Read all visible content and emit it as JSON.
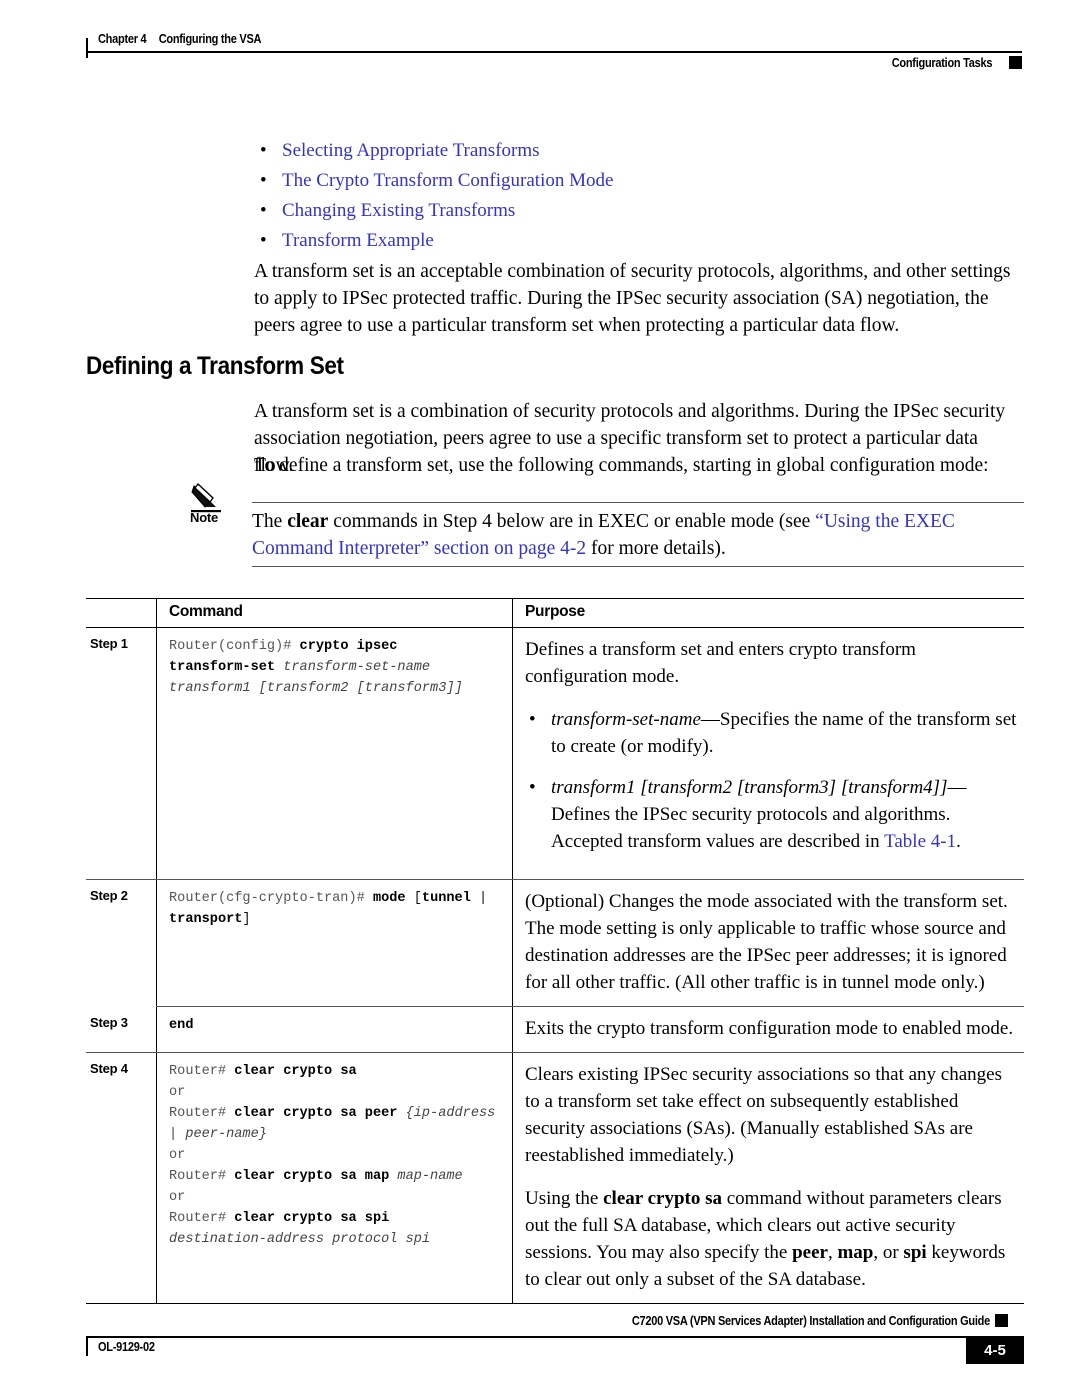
{
  "header": {
    "chapter_number": "Chapter 4",
    "chapter_title": "Configuring the VSA",
    "section": "Configuration Tasks"
  },
  "bullets": [
    {
      "label": "Selecting Appropriate Transforms"
    },
    {
      "label": "The Crypto Transform Configuration Mode"
    },
    {
      "label": "Changing Existing Transforms"
    },
    {
      "label": "Transform Example"
    }
  ],
  "intro_paragraph": "A transform set is an acceptable combination of security protocols, algorithms, and other settings to apply to IPSec protected traffic. During the IPSec security association (SA) negotiation, the peers agree to use a particular transform set when protecting a particular data flow.",
  "heading": "Defining a Transform Set",
  "paragraph_1": "A transform set is a combination of security protocols and algorithms. During the IPSec security association negotiation, peers agree to use a specific transform set to protect a particular data flow.",
  "paragraph_2": "To define a transform set, use the following commands, starting in global configuration mode:",
  "note": {
    "label": "Note",
    "text_part_1": "The ",
    "text_bold": "clear",
    "text_part_2": " commands in Step 4 below are in EXEC or enable mode (see ",
    "link_1": "“Using the EXEC Command Interpreter” section on page 4-2",
    "text_part_3": " for more details)."
  },
  "table": {
    "columns": {
      "step": "",
      "command": "Command",
      "purpose": "Purpose"
    },
    "rows": [
      {
        "step": "Step 1",
        "command_lines": [
          {
            "prompt": "Router(config)# ",
            "bold": "crypto ipsec",
            "italic": ""
          },
          {
            "prompt": "",
            "bold": "transform-set ",
            "italic": "transform-set-name"
          },
          {
            "prompt": "",
            "bold": "",
            "italic": "transform1 [transform2 [transform3]]"
          }
        ],
        "purpose_intro": "Defines a transform set and enters crypto transform configuration mode.",
        "purpose_bullets": [
          {
            "italic_lead": "transform-set-name",
            "rest": "—Specifies the name of the transform set to create (or modify)."
          },
          {
            "italic_lead": "transform1 [transform2 [transform3] [transform4]]",
            "rest": "—Defines the IPSec security protocols and algorithms. Accepted transform values are described in ",
            "link": "Table 4-1",
            "tail": "."
          }
        ]
      },
      {
        "step": "Step 2",
        "command_lines": [
          {
            "prompt": "Router(cfg-crypto-tran)# ",
            "bold": "mode ",
            "plain": "[",
            "bold2": "tunnel",
            "plain2": " |"
          },
          {
            "prompt": "",
            "bold": "transport",
            "plain": "]"
          }
        ],
        "purpose_intro": "(Optional) Changes the mode associated with the transform set. The mode setting is only applicable to traffic whose source and destination addresses are the IPSec peer addresses; it is ignored for all other traffic. (All other traffic is in tunnel mode only.)",
        "purpose_bullets": []
      },
      {
        "step": "Step 3",
        "command_lines": [
          {
            "prompt": "",
            "bold": "end",
            "italic": ""
          }
        ],
        "purpose_intro": "Exits the crypto transform configuration mode to enabled mode.",
        "purpose_bullets": []
      },
      {
        "step": "Step 4",
        "command_lines": [
          {
            "prompt": "Router# ",
            "bold": "clear crypto sa",
            "italic": ""
          },
          {
            "prompt": "or",
            "bold": "",
            "italic": ""
          },
          {
            "prompt": "Router# ",
            "bold": "clear crypto sa peer ",
            "italic": "{ip-address"
          },
          {
            "prompt": "",
            "bold": "",
            "italic": "| peer-name}"
          },
          {
            "prompt": "or",
            "bold": "",
            "italic": ""
          },
          {
            "prompt": "Router# ",
            "bold": "clear crypto sa map ",
            "italic": "map-name"
          },
          {
            "prompt": "or",
            "bold": "",
            "italic": ""
          },
          {
            "prompt": "Router# ",
            "bold": "clear crypto sa spi",
            "italic": ""
          },
          {
            "prompt": "",
            "bold": "",
            "italic": "destination-address protocol spi"
          }
        ],
        "purpose_intro": "Clears existing IPSec security associations so that any changes to a transform set take effect on subsequently established security associations (SAs). (Manually established SAs are reestablished immediately.)",
        "purpose_extra_pre": "Using the ",
        "purpose_extra_bold": "clear crypto sa",
        "purpose_extra_mid": " command without parameters clears out the full SA database, which clears out active security sessions. You may also specify the ",
        "purpose_extra_b1": "peer",
        "purpose_extra_sep1": ", ",
        "purpose_extra_b2": "map",
        "purpose_extra_sep2": ", or ",
        "purpose_extra_b3": "spi",
        "purpose_extra_tail": " keywords to clear out only a subset of the SA database.",
        "purpose_bullets": []
      }
    ]
  },
  "footer": {
    "doc_title": "C7200 VSA (VPN Services Adapter) Installation and Configuration Guide",
    "doc_id": "OL-9129-02",
    "page_number": "4-5"
  },
  "colors": {
    "link": "#3333cc",
    "rule": "#000000",
    "thin_rule": "#555555"
  }
}
